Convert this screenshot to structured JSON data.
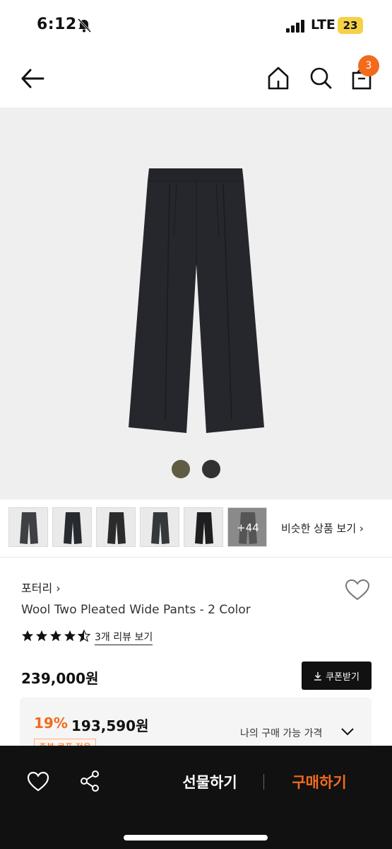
{
  "status_bar": {
    "time": "6:12",
    "network": "LTE",
    "battery": "23",
    "icons": [
      "bell-muted-icon",
      "signal-icon"
    ]
  },
  "header": {
    "icons": [
      "back-arrow-icon",
      "home-icon",
      "search-icon",
      "cart-icon"
    ],
    "cart_count": "3"
  },
  "product_image": {
    "color_swatches": [
      {
        "name": "olive",
        "color": "#5f5c44"
      },
      {
        "name": "charcoal",
        "color": "#323233"
      }
    ]
  },
  "thumbnails": {
    "count_visible": 6,
    "more_label": "+44",
    "similar_link": "비슷한 상품 보기 ›"
  },
  "product": {
    "brand": "포터리 ›",
    "title": "Wool Two Pleated Wide Pants - 2 Color",
    "rating": 4.5,
    "review_link": "3개 리뷰 보기",
    "price": "239,000원",
    "coupon_button": "쿠폰받기"
  },
  "discount": {
    "rate": "19%",
    "price": "193,590원",
    "my_price_label": "나의 구매 가능 가격",
    "coupon_tag": "중복 쿠폰 적용"
  },
  "bottom_bar": {
    "gift_label": "선물하기",
    "buy_label": "구매하기",
    "accent_color": "#f26b1d"
  }
}
